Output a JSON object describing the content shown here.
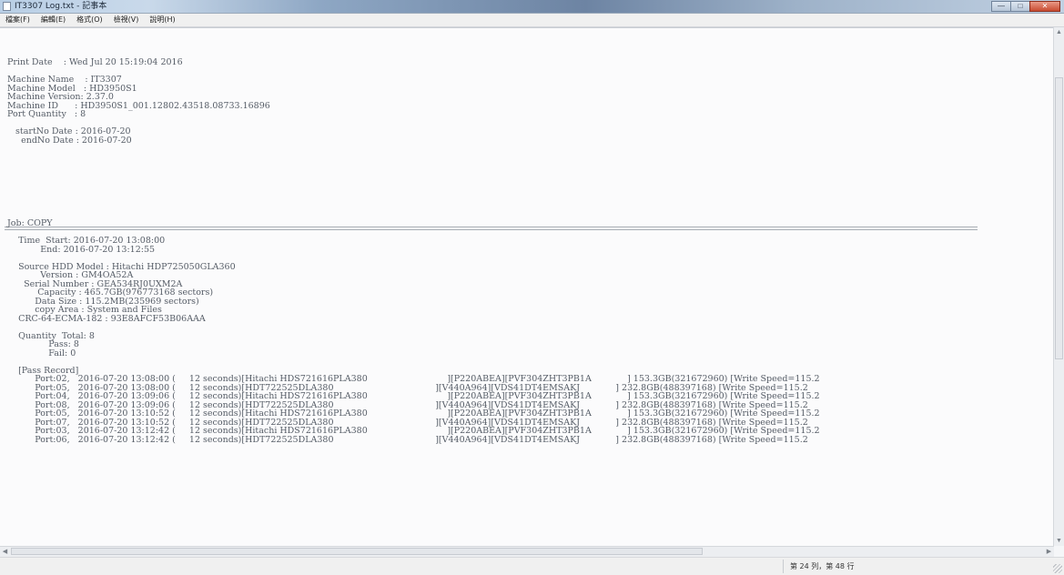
{
  "window": {
    "title": "IT3307 Log.txt - 記事本",
    "controls": {
      "minimize": "—",
      "maximize": "□",
      "close": "✕"
    },
    "icon": "notepad-icon"
  },
  "menu": [
    "檔案(F)",
    "編輯(E)",
    "格式(O)",
    "檢視(V)",
    "說明(H)"
  ],
  "header": [
    "Print Date    : Wed Jul 20 15:19:04 2016",
    "",
    "Machine Name    : IT3307",
    "Machine Model   : HD3950S1",
    "Machine Version: 2.37.0",
    "Machine ID      : HD3950S1_001.12802.43518.08733.16896",
    "Port Quantity   : 8",
    "",
    "   startNo Date : 2016-07-20",
    "     endNo Date : 2016-07-20"
  ],
  "job": [
    "Job: COPY",
    "",
    "    Time  Start: 2016-07-20 13:08:00",
    "            End: 2016-07-20 13:12:55",
    "",
    "    Source HDD Model : Hitachi HDP725050GLA360",
    "            Version : GM4OA52A",
    "      Serial Number : GEA534RJ0UXM2A",
    "           Capacity : 465.7GB(976773168 sectors)",
    "          Data Size : 115.2MB(235969 sectors)",
    "          copy Area : System and Files",
    "    CRC-64-ECMA-182 : 93E8AFCF53B06AAA",
    "",
    "    Quantity  Total: 8",
    "               Pass: 8",
    "               Fail: 0",
    "",
    "    [Pass Record]",
    "          Port:02,   2016-07-20 13:08:00 (     12 seconds)[Hitachi HDS721616PLA380                             ][P220ABEA][PVF304ZHT3PB1A             ] 153.3GB(321672960) [Write Speed=115.2",
    "          Port:05,   2016-07-20 13:08:00 (     12 seconds)[HDT722525DLA380                                     ][V440A964][VDS41DT4EMSAKJ             ] 232.8GB(488397168) [Write Speed=115.2",
    "          Port:04,   2016-07-20 13:09:06 (     12 seconds)[Hitachi HDS721616PLA380                             ][P220ABEA][PVF304ZHT3PB1A             ] 153.3GB(321672960) [Write Speed=115.2",
    "          Port:08,   2016-07-20 13:09:06 (     12 seconds)[HDT722525DLA380                                     ][V440A964][VDS41DT4EMSAKJ             ] 232.8GB(488397168) [Write Speed=115.2",
    "          Port:05,   2016-07-20 13:10:52 (     12 seconds)[Hitachi HDS721616PLA380                             ][P220ABEA][PVF304ZHT3PB1A             ] 153.3GB(321672960) [Write Speed=115.2",
    "          Port:07,   2016-07-20 13:10:52 (     12 seconds)[HDT722525DLA380                                     ][V440A964][VDS41DT4EMSAKJ             ] 232.8GB(488397168) [Write Speed=115.2",
    "          Port:03,   2016-07-20 13:12:42 (     12 seconds)[Hitachi HDS721616PLA380                             ][P220ABEA][PVF304ZHT3PB1A             ] 153.3GB(321672960) [Write Speed=115.2",
    "          Port:06,   2016-07-20 13:12:42 (     12 seconds)[HDT722525DLA380                                     ][V440A964][VDS41DT4EMSAKJ             ] 232.8GB(488397168) [Write Speed=115.2"
  ],
  "status": {
    "position": "第 24 列，第 48 行"
  }
}
